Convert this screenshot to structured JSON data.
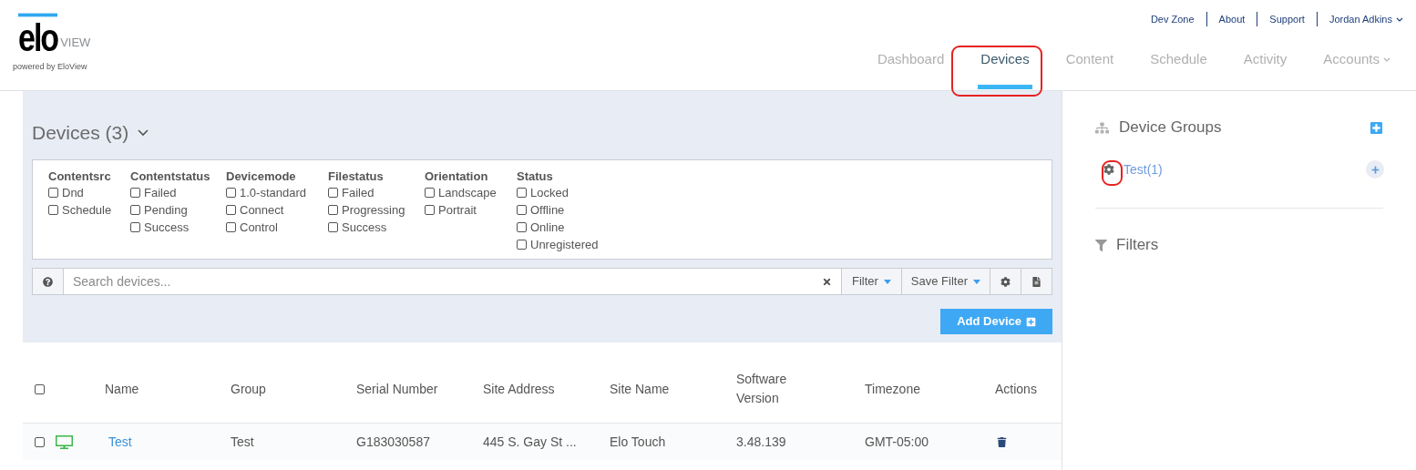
{
  "logo": {
    "mark": "elo",
    "sub": "VIEW",
    "tagline": "powered by EloView"
  },
  "top_links": [
    {
      "label": "Dev Zone",
      "dropdown": false
    },
    {
      "label": "About",
      "dropdown": false
    },
    {
      "label": "Support",
      "dropdown": false
    },
    {
      "label": "Jordan Adkins",
      "dropdown": true
    }
  ],
  "nav_tabs": [
    {
      "label": "Dashboard",
      "selected": false,
      "dropdown": false
    },
    {
      "label": "Devices",
      "selected": true,
      "dropdown": false
    },
    {
      "label": "Content",
      "selected": false,
      "dropdown": false
    },
    {
      "label": "Schedule",
      "selected": false,
      "dropdown": false
    },
    {
      "label": "Activity",
      "selected": false,
      "dropdown": false
    },
    {
      "label": "Accounts",
      "selected": false,
      "dropdown": true
    }
  ],
  "devices_title": "Devices (3)",
  "filter_groups": [
    {
      "title": "Contentsrc",
      "options": [
        {
          "label": "Dnd",
          "checked": false
        },
        {
          "label": "Schedule",
          "checked": false
        }
      ]
    },
    {
      "title": "Contentstatus",
      "options": [
        {
          "label": "Failed",
          "checked": false
        },
        {
          "label": "Pending",
          "checked": false
        },
        {
          "label": "Success",
          "checked": false
        }
      ]
    },
    {
      "title": "Devicemode",
      "options": [
        {
          "label": "1.0-standard",
          "checked": false
        },
        {
          "label": "Connect",
          "checked": false
        },
        {
          "label": "Control",
          "checked": false
        }
      ]
    },
    {
      "title": "Filestatus",
      "options": [
        {
          "label": "Failed",
          "checked": false
        },
        {
          "label": "Progressing",
          "checked": false
        },
        {
          "label": "Success",
          "checked": false
        }
      ]
    },
    {
      "title": "Orientation",
      "options": [
        {
          "label": "Landscape",
          "checked": false
        },
        {
          "label": "Portrait",
          "checked": false
        }
      ]
    },
    {
      "title": "Status",
      "options": [
        {
          "label": "Locked",
          "checked": false
        },
        {
          "label": "Offline",
          "checked": false
        },
        {
          "label": "Online",
          "checked": false
        },
        {
          "label": "Unregistered",
          "checked": false
        }
      ]
    }
  ],
  "search": {
    "placeholder": "Search devices..."
  },
  "filter_button": "Filter",
  "save_filter_button": "Save Filter",
  "add_button": "Add Device",
  "table": {
    "select_all_checked": false,
    "columns": [
      "Name",
      "Group",
      "Serial Number",
      "Site Address",
      "Site Name",
      "Software Version",
      "Timezone",
      "Actions"
    ],
    "rows": [
      {
        "checked": false,
        "color": "#3cb54a",
        "name": "Test",
        "group": "Test",
        "serial": "G183030587",
        "site_address": "445 S. Gay St ...",
        "site_name": "Elo Touch",
        "software_version": "3.48.139",
        "timezone": "GMT-05:00"
      }
    ]
  },
  "sidebar": {
    "groups_title": "Device Groups",
    "groups": [
      {
        "label": "Test(1)"
      }
    ],
    "filters_title": "Filters"
  }
}
